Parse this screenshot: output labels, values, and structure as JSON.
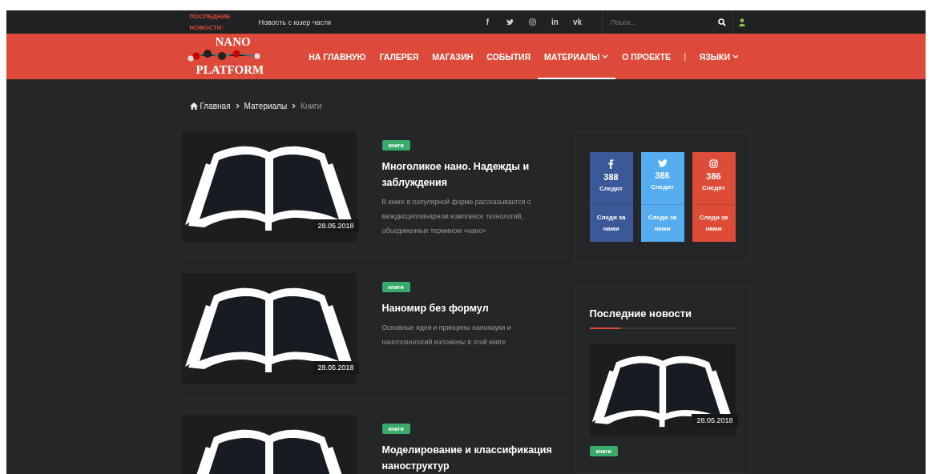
{
  "top_bar": {
    "ticker_label": "ПОСЛЕДНИЕ НОВОСТИ:",
    "ticker_text": "Новость с юзер части",
    "social": [
      {
        "kind": "text",
        "label": "f"
      },
      {
        "kind": "twitter"
      },
      {
        "kind": "instagram"
      },
      {
        "kind": "text",
        "label": "in"
      },
      {
        "kind": "text",
        "label": "vk"
      }
    ],
    "search": {
      "placeholder": "Поиск..."
    }
  },
  "header": {
    "logo": {
      "line_1": "NANO",
      "line_2": "PLATFORM"
    },
    "nav": [
      {
        "label": "НА ГЛАВНУЮ",
        "selected": false,
        "dropdown": false
      },
      {
        "label": "ГАЛЕРЕЯ",
        "selected": false,
        "dropdown": false
      },
      {
        "label": "МАГАЗИН",
        "selected": false,
        "dropdown": false
      },
      {
        "label": "СОБЫТИЯ",
        "selected": false,
        "dropdown": false
      },
      {
        "label": "МАТЕРИАЛЫ",
        "selected": true,
        "dropdown": true
      },
      {
        "label": "О ПРОЕКТЕ",
        "selected": false,
        "dropdown": false
      },
      {
        "label": "|",
        "kind": "separator"
      },
      {
        "label": "ЯЗЫКИ",
        "selected": false,
        "dropdown": true
      }
    ]
  },
  "breadcrumb": [
    {
      "label": "Главная",
      "kind": "home",
      "current": false
    },
    {
      "label": "Материалы",
      "current": false
    },
    {
      "label": "Книги",
      "current": true
    }
  ],
  "articles": [
    {
      "category": "книги",
      "title": "Многоликое нано. Надежды и заблуждения",
      "excerpt": "В книге в популярной форме рассказывается о междисциплинарном комплексе технологий, объединенных термином «нано»",
      "date": "28.05.2018"
    },
    {
      "category": "книги",
      "title": "Наномир без формул",
      "excerpt": "Основные идеи и принципы нанонауки и нанотехнологий изложены в этой книге",
      "date": "28.05.2018"
    },
    {
      "category": "книги",
      "title": "Моделирование и классификация наноструктур"
    }
  ],
  "social_widget": [
    {
      "kind": "facebook",
      "color": "#3b5998",
      "count": "388",
      "label": "Следят",
      "action": "Следи за нами"
    },
    {
      "kind": "twitter",
      "color": "#55acee",
      "count": "386",
      "label": "Следят",
      "action": "Следи за нами"
    },
    {
      "kind": "instagram",
      "color": "#dd4b39",
      "count": "386",
      "label": "Следят",
      "action": "Следи за нами"
    }
  ],
  "news_widget": {
    "title": "Последние новости",
    "items": [
      {
        "date": "28.05.2018",
        "category": "книги"
      }
    ]
  }
}
